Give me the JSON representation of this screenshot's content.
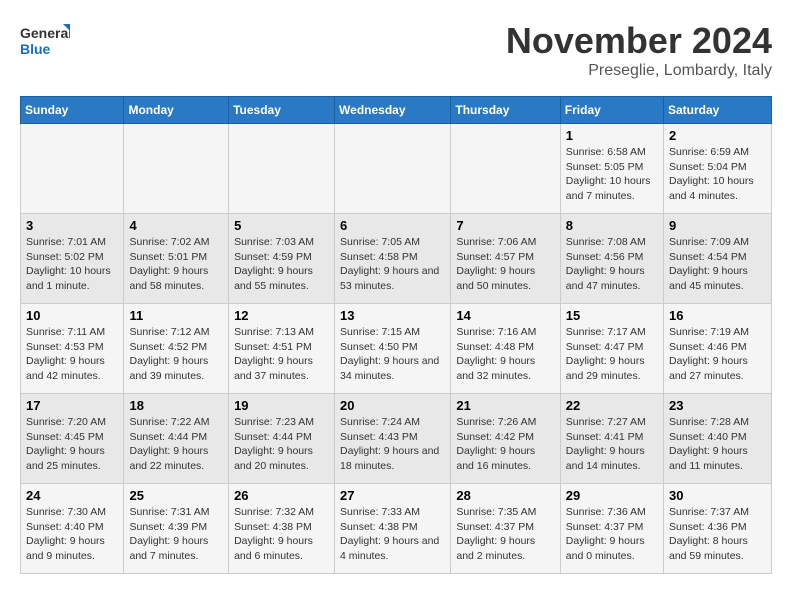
{
  "logo": {
    "line1": "General",
    "line2": "Blue"
  },
  "title": "November 2024",
  "subtitle": "Preseglie, Lombardy, Italy",
  "days_of_week": [
    "Sunday",
    "Monday",
    "Tuesday",
    "Wednesday",
    "Thursday",
    "Friday",
    "Saturday"
  ],
  "weeks": [
    [
      {
        "day": "",
        "info": ""
      },
      {
        "day": "",
        "info": ""
      },
      {
        "day": "",
        "info": ""
      },
      {
        "day": "",
        "info": ""
      },
      {
        "day": "",
        "info": ""
      },
      {
        "day": "1",
        "info": "Sunrise: 6:58 AM\nSunset: 5:05 PM\nDaylight: 10 hours and 7 minutes."
      },
      {
        "day": "2",
        "info": "Sunrise: 6:59 AM\nSunset: 5:04 PM\nDaylight: 10 hours and 4 minutes."
      }
    ],
    [
      {
        "day": "3",
        "info": "Sunrise: 7:01 AM\nSunset: 5:02 PM\nDaylight: 10 hours and 1 minute."
      },
      {
        "day": "4",
        "info": "Sunrise: 7:02 AM\nSunset: 5:01 PM\nDaylight: 9 hours and 58 minutes."
      },
      {
        "day": "5",
        "info": "Sunrise: 7:03 AM\nSunset: 4:59 PM\nDaylight: 9 hours and 55 minutes."
      },
      {
        "day": "6",
        "info": "Sunrise: 7:05 AM\nSunset: 4:58 PM\nDaylight: 9 hours and 53 minutes."
      },
      {
        "day": "7",
        "info": "Sunrise: 7:06 AM\nSunset: 4:57 PM\nDaylight: 9 hours and 50 minutes."
      },
      {
        "day": "8",
        "info": "Sunrise: 7:08 AM\nSunset: 4:56 PM\nDaylight: 9 hours and 47 minutes."
      },
      {
        "day": "9",
        "info": "Sunrise: 7:09 AM\nSunset: 4:54 PM\nDaylight: 9 hours and 45 minutes."
      }
    ],
    [
      {
        "day": "10",
        "info": "Sunrise: 7:11 AM\nSunset: 4:53 PM\nDaylight: 9 hours and 42 minutes."
      },
      {
        "day": "11",
        "info": "Sunrise: 7:12 AM\nSunset: 4:52 PM\nDaylight: 9 hours and 39 minutes."
      },
      {
        "day": "12",
        "info": "Sunrise: 7:13 AM\nSunset: 4:51 PM\nDaylight: 9 hours and 37 minutes."
      },
      {
        "day": "13",
        "info": "Sunrise: 7:15 AM\nSunset: 4:50 PM\nDaylight: 9 hours and 34 minutes."
      },
      {
        "day": "14",
        "info": "Sunrise: 7:16 AM\nSunset: 4:48 PM\nDaylight: 9 hours and 32 minutes."
      },
      {
        "day": "15",
        "info": "Sunrise: 7:17 AM\nSunset: 4:47 PM\nDaylight: 9 hours and 29 minutes."
      },
      {
        "day": "16",
        "info": "Sunrise: 7:19 AM\nSunset: 4:46 PM\nDaylight: 9 hours and 27 minutes."
      }
    ],
    [
      {
        "day": "17",
        "info": "Sunrise: 7:20 AM\nSunset: 4:45 PM\nDaylight: 9 hours and 25 minutes."
      },
      {
        "day": "18",
        "info": "Sunrise: 7:22 AM\nSunset: 4:44 PM\nDaylight: 9 hours and 22 minutes."
      },
      {
        "day": "19",
        "info": "Sunrise: 7:23 AM\nSunset: 4:44 PM\nDaylight: 9 hours and 20 minutes."
      },
      {
        "day": "20",
        "info": "Sunrise: 7:24 AM\nSunset: 4:43 PM\nDaylight: 9 hours and 18 minutes."
      },
      {
        "day": "21",
        "info": "Sunrise: 7:26 AM\nSunset: 4:42 PM\nDaylight: 9 hours and 16 minutes."
      },
      {
        "day": "22",
        "info": "Sunrise: 7:27 AM\nSunset: 4:41 PM\nDaylight: 9 hours and 14 minutes."
      },
      {
        "day": "23",
        "info": "Sunrise: 7:28 AM\nSunset: 4:40 PM\nDaylight: 9 hours and 11 minutes."
      }
    ],
    [
      {
        "day": "24",
        "info": "Sunrise: 7:30 AM\nSunset: 4:40 PM\nDaylight: 9 hours and 9 minutes."
      },
      {
        "day": "25",
        "info": "Sunrise: 7:31 AM\nSunset: 4:39 PM\nDaylight: 9 hours and 7 minutes."
      },
      {
        "day": "26",
        "info": "Sunrise: 7:32 AM\nSunset: 4:38 PM\nDaylight: 9 hours and 6 minutes."
      },
      {
        "day": "27",
        "info": "Sunrise: 7:33 AM\nSunset: 4:38 PM\nDaylight: 9 hours and 4 minutes."
      },
      {
        "day": "28",
        "info": "Sunrise: 7:35 AM\nSunset: 4:37 PM\nDaylight: 9 hours and 2 minutes."
      },
      {
        "day": "29",
        "info": "Sunrise: 7:36 AM\nSunset: 4:37 PM\nDaylight: 9 hours and 0 minutes."
      },
      {
        "day": "30",
        "info": "Sunrise: 7:37 AM\nSunset: 4:36 PM\nDaylight: 8 hours and 59 minutes."
      }
    ]
  ]
}
